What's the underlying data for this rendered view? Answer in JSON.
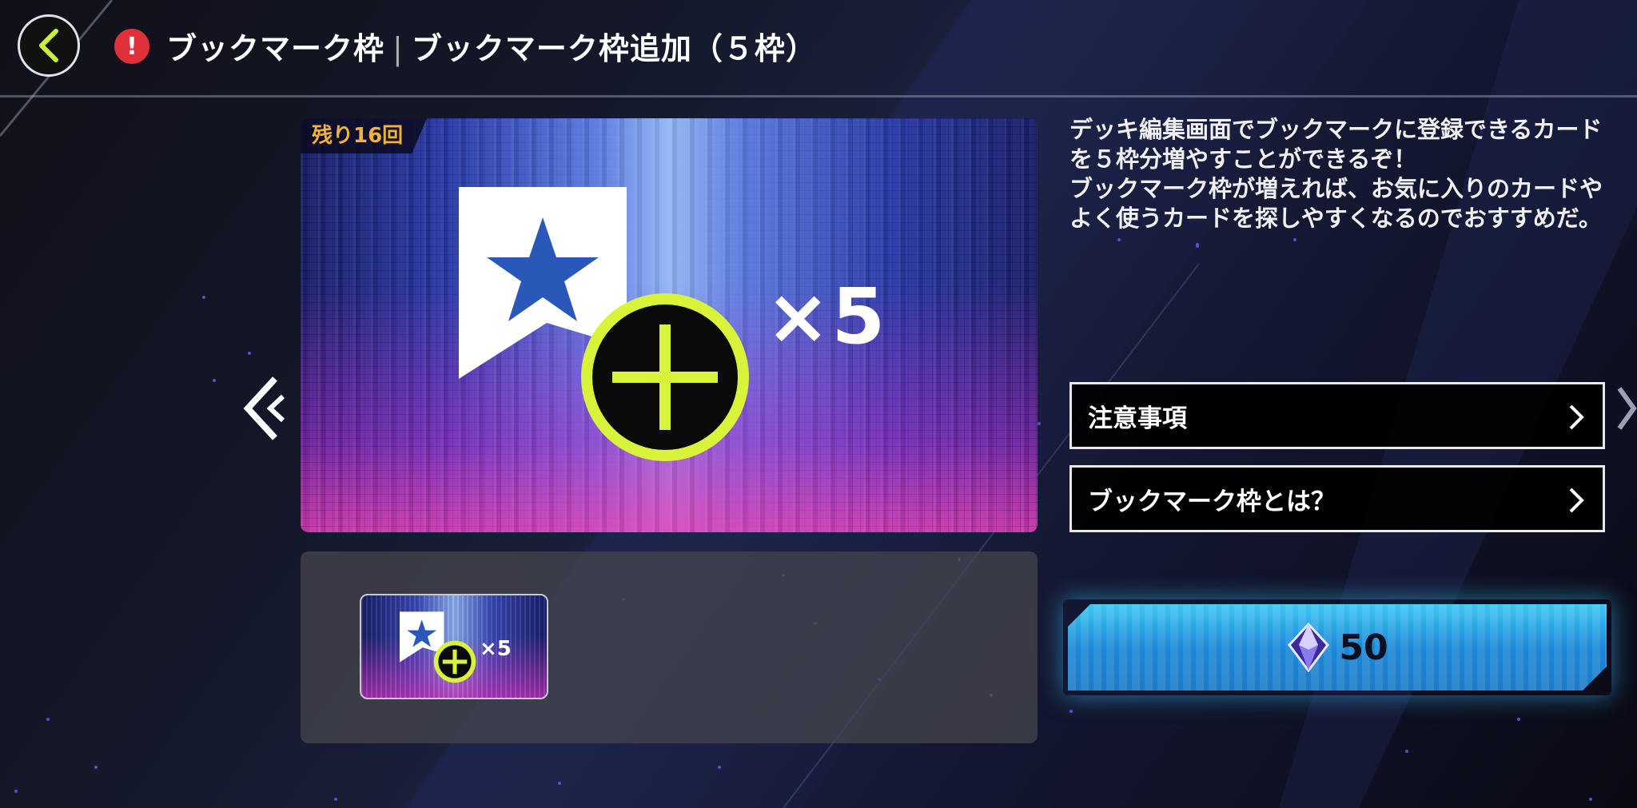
{
  "header": {
    "title_main": "ブックマーク枠",
    "title_separator": "|",
    "title_sub": "ブックマーク枠追加（５枠）"
  },
  "product": {
    "remaining_label": "残り16回",
    "multiplier": "×5"
  },
  "thumbnail": {
    "multiplier": "×5"
  },
  "description": {
    "paragraph_1": "デッキ編集画面でブックマークに登録できるカードを５枠分増やすことができるぞ！",
    "paragraph_2": "ブックマーク枠が増えれば、お気に入りのカードやよく使うカードを探しやすくなるのでおすすめだ。"
  },
  "menu": {
    "notes_label": "注意事項",
    "about_label": "ブックマーク枠とは？"
  },
  "purchase": {
    "price": "50",
    "currency_icon": "gem-icon"
  },
  "colors": {
    "accent_yellow": "#d9f23a",
    "alert_red": "#e0303a",
    "badge_orange": "#f1b23c",
    "purchase_blue": "#2aa8e8"
  }
}
